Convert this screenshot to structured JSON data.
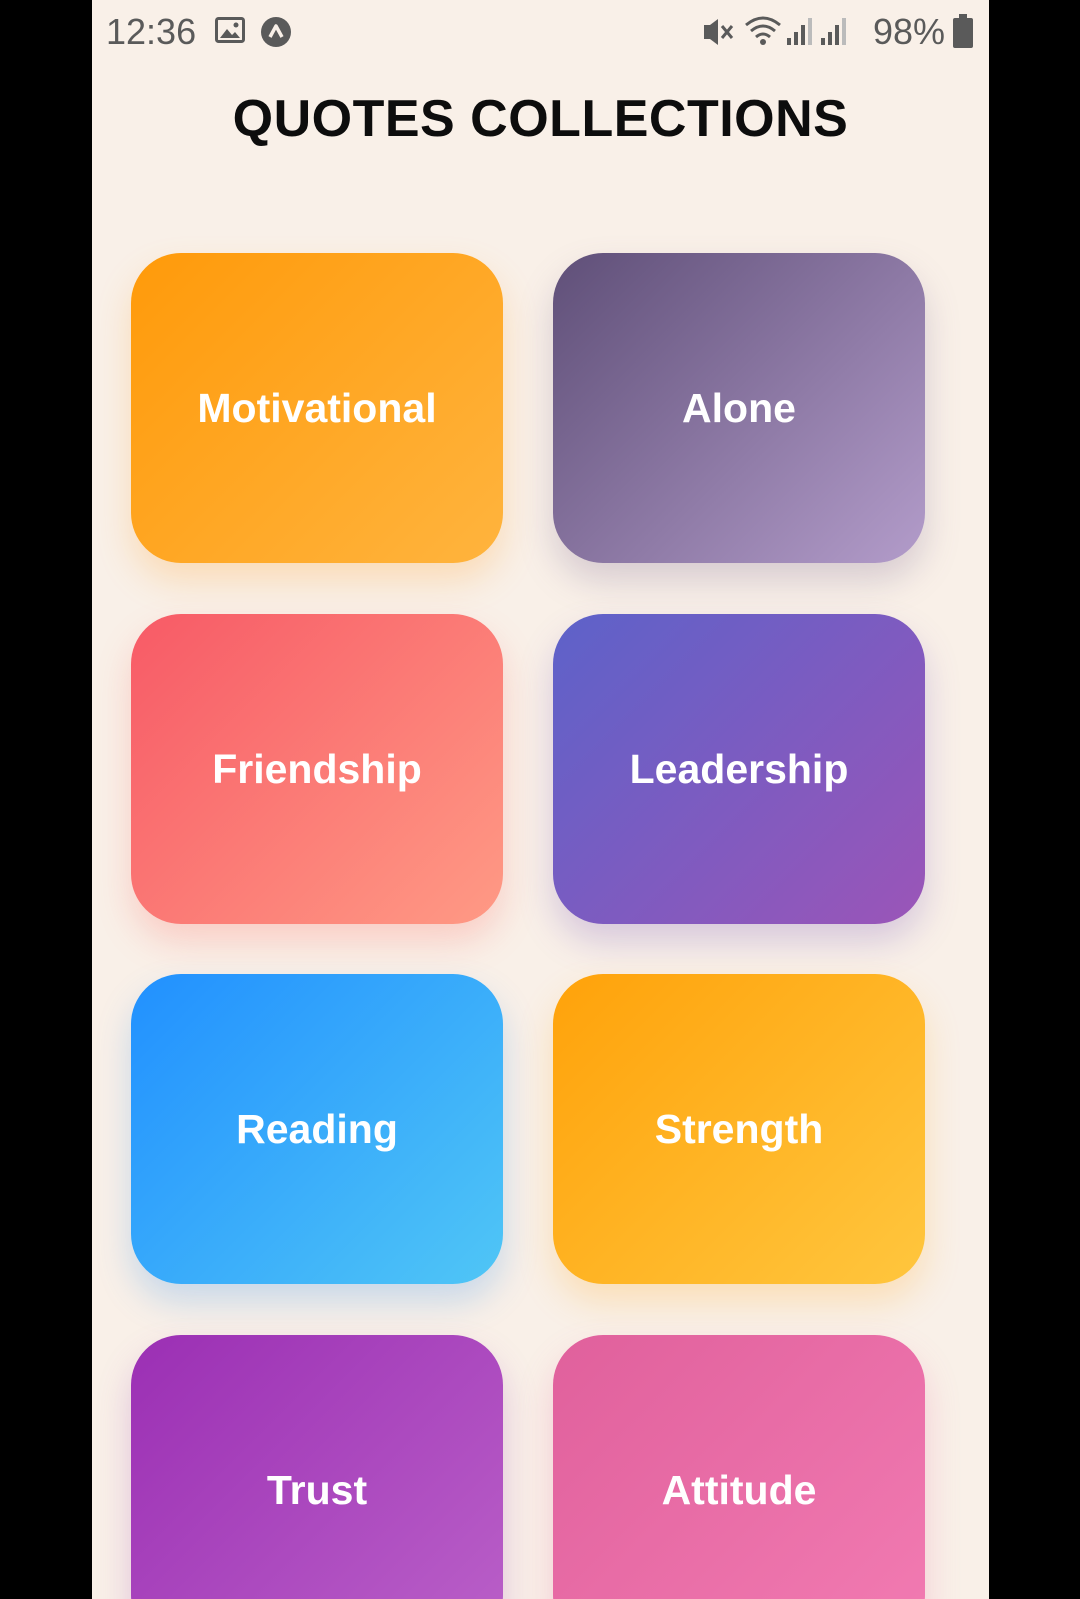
{
  "status_bar": {
    "time": "12:36",
    "battery_percent": "98%",
    "icons": [
      "gallery-icon",
      "app-notification-icon",
      "vibrate-mute-icon",
      "wifi-icon",
      "signal-icon-1",
      "signal-icon-2",
      "battery-icon"
    ]
  },
  "header": {
    "title": "QUOTES COLLECTIONS"
  },
  "categories": [
    {
      "label": "Motivational",
      "colors": [
        "#ff9a0a",
        "#ffb43e"
      ]
    },
    {
      "label": "Alone",
      "colors": [
        "#5f4f78",
        "#b39cca"
      ]
    },
    {
      "label": "Friendship",
      "colors": [
        "#f75a66",
        "#ff9a85"
      ]
    },
    {
      "label": "Leadership",
      "colors": [
        "#5d62c9",
        "#9b55b8"
      ]
    },
    {
      "label": "Reading",
      "colors": [
        "#2190ff",
        "#50c6f6"
      ]
    },
    {
      "label": "Strength",
      "colors": [
        "#ffa20a",
        "#ffc63e"
      ]
    },
    {
      "label": "Trust",
      "colors": [
        "#9b2fb4",
        "#ba60c8"
      ]
    },
    {
      "label": "Attitude",
      "colors": [
        "#e0609c",
        "#f27bb2"
      ]
    }
  ],
  "colors": {
    "background": "#f9f0e8",
    "title": "#0d0d0d",
    "card_text": "#ffffff"
  }
}
